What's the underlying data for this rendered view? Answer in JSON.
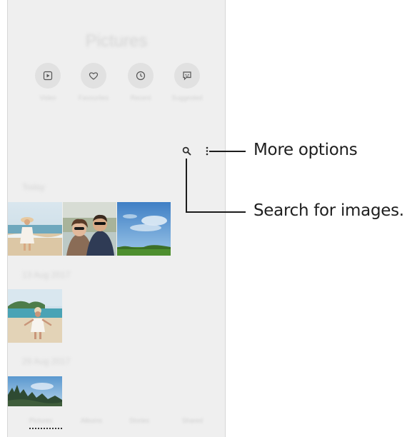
{
  "header": {
    "title": "Pictures"
  },
  "quick_actions": [
    {
      "label": "Video",
      "icon": "play-icon"
    },
    {
      "label": "Favourites",
      "icon": "heart-icon"
    },
    {
      "label": "Recent",
      "icon": "clock-icon"
    },
    {
      "label": "Suggested",
      "icon": "suggestion-icon"
    }
  ],
  "toolbar": {
    "search_icon": "search-icon",
    "more_icon": "more-options-icon"
  },
  "sections": [
    {
      "label": "Today",
      "count": 3
    },
    {
      "label": "13 Aug 2017",
      "count": 1
    },
    {
      "label": "29 Aug 2017",
      "count": 1
    }
  ],
  "bottom_tabs": [
    "Pictures",
    "Albums",
    "Stories",
    "Shared"
  ],
  "callouts": {
    "more_options": "More options",
    "search": "Search for images."
  },
  "colors": {
    "screen_bg": "#efefef",
    "callout_line": "#1c1c1c",
    "selected_tab": "#333333"
  }
}
